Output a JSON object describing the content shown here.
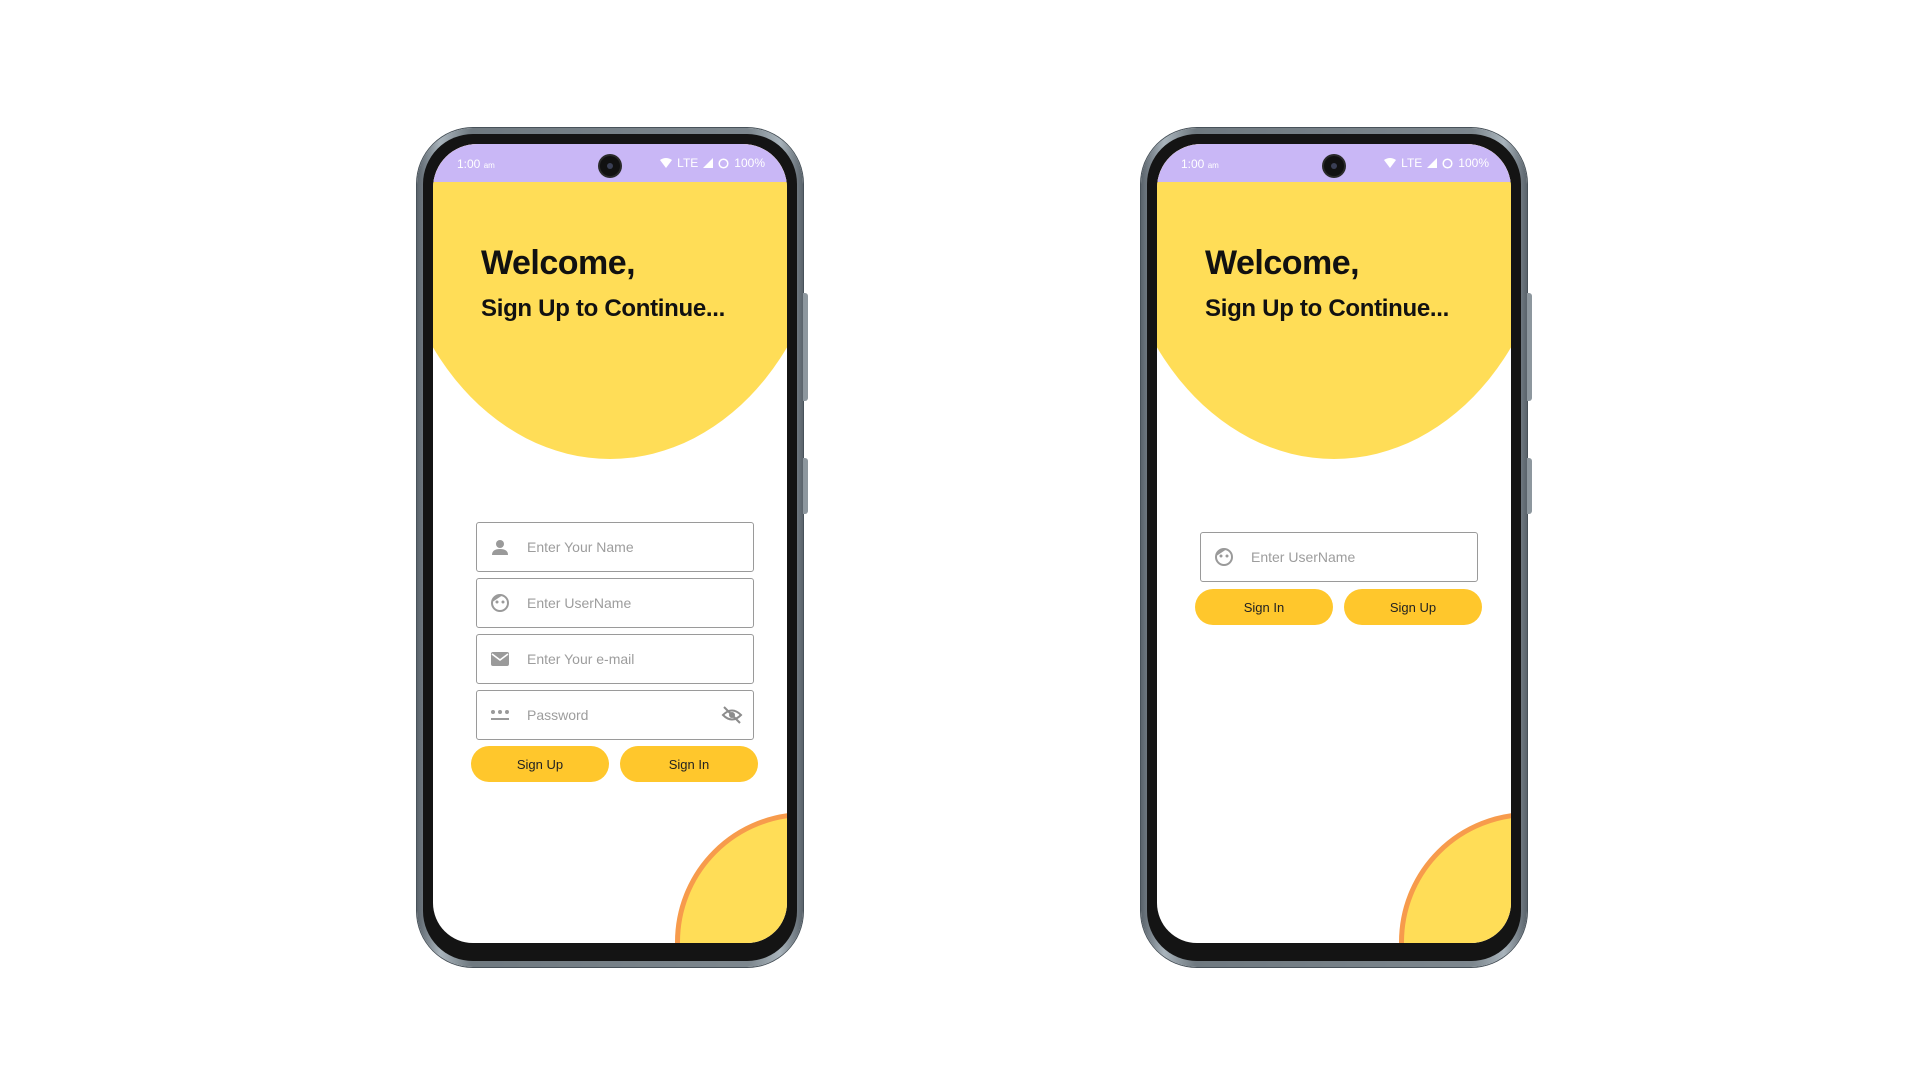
{
  "status": {
    "time": "1:00",
    "ampm": "am",
    "network": "LTE",
    "battery": "100%"
  },
  "signup_screen": {
    "welcome": "Welcome,",
    "subtitle": "Sign Up to Continue...",
    "fields": {
      "name_placeholder": "Enter Your Name",
      "username_placeholder": "Enter UserName",
      "email_placeholder": "Enter Your e-mail",
      "password_placeholder": "Password"
    },
    "buttons": {
      "primary": "Sign Up",
      "secondary": "Sign In"
    }
  },
  "signin_screen": {
    "welcome": "Welcome,",
    "subtitle": "Sign Up to Continue...",
    "fields": {
      "username_placeholder": "Enter UserName"
    },
    "buttons": {
      "primary": "Sign In",
      "secondary": "Sign Up"
    }
  },
  "colors": {
    "accent_yellow": "#ffdd57",
    "button_yellow": "#ffc72c",
    "status_bar": "#c9b7f6",
    "blob_border": "#f79b4c"
  }
}
